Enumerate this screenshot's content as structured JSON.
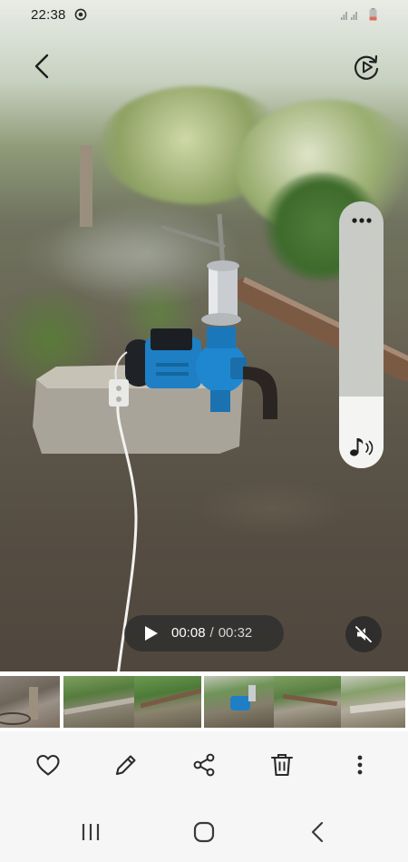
{
  "status_bar": {
    "time": "22:38",
    "app_icon": "screen-record-icon",
    "signal_icon": "dual-signal-icon",
    "battery_icon": "battery-low-icon",
    "battery_color": "#e0695a"
  },
  "viewer": {
    "back_icon": "back-arrow-icon",
    "motion_photo_icon": "motion-photo-play-icon"
  },
  "volume": {
    "level": 0.27,
    "more_icon": "more-dots-icon",
    "sound_icon": "music-note-sound-icon"
  },
  "playback": {
    "current_time": "00:08",
    "separator": "/",
    "total_time": "00:32",
    "play_icon": "play-icon",
    "mute_icon": "volume-muted-icon",
    "position": 0.25
  },
  "actions": [
    {
      "name": "favorite",
      "icon": "heart-icon"
    },
    {
      "name": "edit",
      "icon": "pencil-icon"
    },
    {
      "name": "share",
      "icon": "share-icon"
    },
    {
      "name": "delete",
      "icon": "trash-icon"
    },
    {
      "name": "more",
      "icon": "more-vertical-icon"
    }
  ],
  "navigation": [
    {
      "name": "recent-apps",
      "icon": "recent-apps-icon"
    },
    {
      "name": "home",
      "icon": "home-icon"
    },
    {
      "name": "back",
      "icon": "nav-back-icon"
    }
  ],
  "colors": {
    "pump_body": "#1e7fc4",
    "bar_background": "#f6f6f6",
    "icon": "#2b2b2b"
  }
}
